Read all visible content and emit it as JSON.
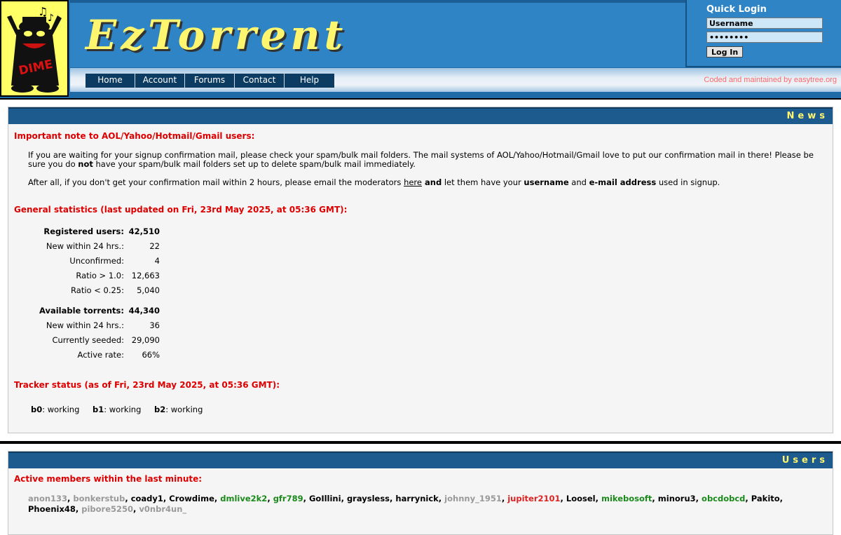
{
  "site": {
    "title": "EzTorrent",
    "logo_text": "DIME",
    "copyright": "Coded and maintained by easytree.org"
  },
  "nav": [
    "Home",
    "Account",
    "Forums",
    "Contact",
    "Help"
  ],
  "quick_login": {
    "title": "Quick Login",
    "username_value": "Username",
    "password_value": "••••••••",
    "button_label": "Log In"
  },
  "news": {
    "panel_title": "News",
    "notice_heading": "Important note to AOL/Yahoo/Hotmail/Gmail users:",
    "paragraph1_a": "If you are waiting for your signup confirmation mail, please check your spam/bulk mail folders. The mail systems of AOL/Yahoo/Hotmail/Gmail love to put our confirmation mail in there! Please be sure you do ",
    "paragraph1_bold": "not",
    "paragraph1_b": " have your spam/bulk mail folders set up to delete spam/bulk mail immediately.",
    "paragraph2_a": "After all, if you don't get your confirmation mail within 2 hours, please email the moderators ",
    "paragraph2_link": "here",
    "paragraph2_bold1": "and",
    "paragraph2_b": " let them have your ",
    "paragraph2_bold2": "username",
    "paragraph2_c": " and ",
    "paragraph2_bold3": "e-mail address",
    "paragraph2_d": " used in signup.",
    "stats_heading": "General statistics (last updated on Fri, 23rd May 2025, at 05:36 GMT):",
    "stats_users": [
      {
        "label": "Registered users:",
        "value": "42,510",
        "bold": true
      },
      {
        "label": "New within 24 hrs.:",
        "value": "22"
      },
      {
        "label": "Unconfirmed:",
        "value": "4"
      },
      {
        "label": "Ratio > 1.0:",
        "value": "12,663"
      },
      {
        "label": "Ratio < 0.25:",
        "value": "5,040"
      }
    ],
    "stats_torrents": [
      {
        "label": "Available torrents:",
        "value": "44,340",
        "bold": true
      },
      {
        "label": "New within 24 hrs.:",
        "value": "36"
      },
      {
        "label": "Currently seeded:",
        "value": "29,090"
      },
      {
        "label": "Active rate:",
        "value": "66%"
      }
    ],
    "tracker_heading": "Tracker status (as of Fri, 23rd May 2025, at 05:36 GMT):",
    "trackers": [
      {
        "name": "b0",
        "status": ": working"
      },
      {
        "name": "b1",
        "status": ": working"
      },
      {
        "name": "b2",
        "status": ": working"
      }
    ]
  },
  "users": {
    "panel_title": "Users",
    "active_heading": "Active members within the last minute:",
    "members": [
      {
        "name": "anon133",
        "color": "#999999"
      },
      {
        "name": "bonkerstub",
        "color": "#999999"
      },
      {
        "name": "coady1",
        "color": "#000000"
      },
      {
        "name": "Crowdime",
        "color": "#000000"
      },
      {
        "name": "dmlive2k2",
        "color": "#1a8a1a"
      },
      {
        "name": "gfr789",
        "color": "#1a8a1a"
      },
      {
        "name": "GoIllini",
        "color": "#000000"
      },
      {
        "name": "graysless",
        "color": "#000000"
      },
      {
        "name": "harrynick",
        "color": "#000000"
      },
      {
        "name": "johnny_1951",
        "color": "#999999"
      },
      {
        "name": "jupiter2101",
        "color": "#dd2222"
      },
      {
        "name": "Loosel",
        "color": "#000000"
      },
      {
        "name": "mikebosoft",
        "color": "#1a8a1a"
      },
      {
        "name": "minoru3",
        "color": "#000000"
      },
      {
        "name": "obcdobcd",
        "color": "#1a8a1a"
      },
      {
        "name": "Pakito",
        "color": "#000000"
      },
      {
        "name": "Phoenix48",
        "color": "#000000"
      },
      {
        "name": "pibore5250",
        "color": "#999999"
      },
      {
        "name": "v0nbr4un_",
        "color": "#999999"
      }
    ]
  }
}
